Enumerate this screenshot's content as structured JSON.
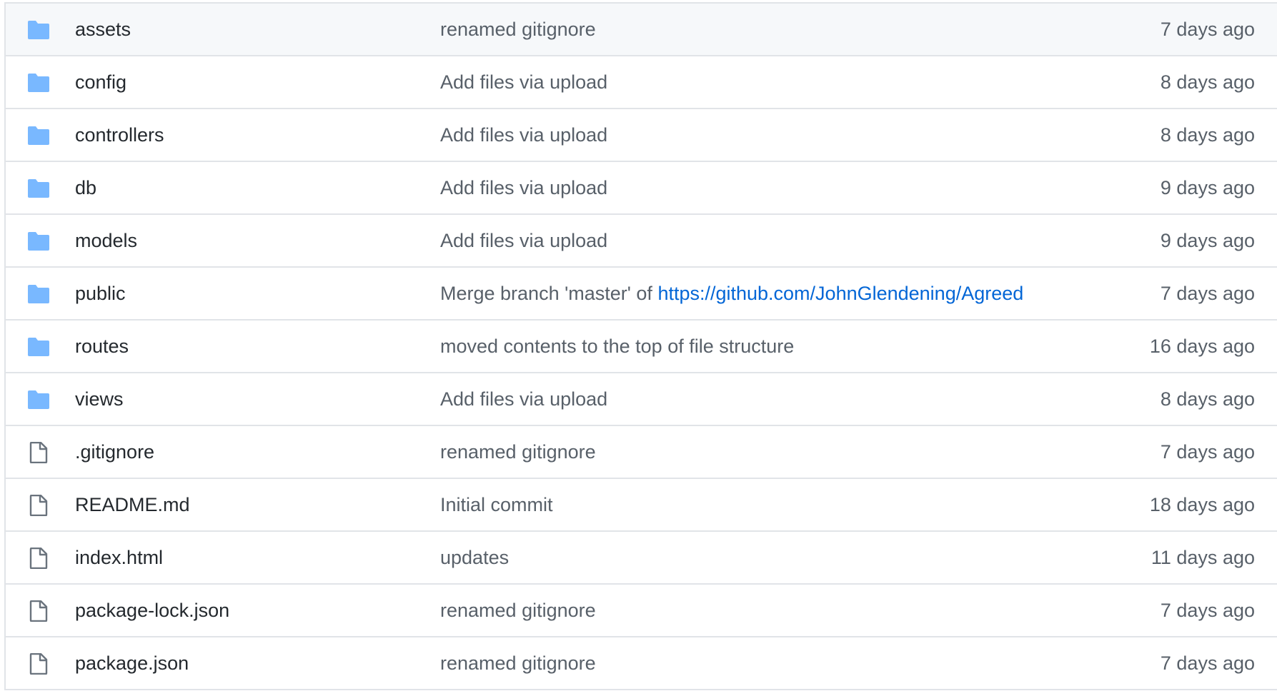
{
  "colors": {
    "folder_icon": "#79b8ff",
    "file_icon": "#6a737d",
    "link": "#0366d6",
    "muted_text": "#586069",
    "primary_text": "#24292e",
    "border": "#e1e4e8",
    "highlight_row": "#f6f8fa"
  },
  "rows": [
    {
      "type": "folder",
      "icon": "folder-icon",
      "name": "assets",
      "message": "renamed gitignore",
      "age": "7 days ago"
    },
    {
      "type": "folder",
      "icon": "folder-icon",
      "name": "config",
      "message": "Add files via upload",
      "age": "8 days ago"
    },
    {
      "type": "folder",
      "icon": "folder-icon",
      "name": "controllers",
      "message": "Add files via upload",
      "age": "8 days ago"
    },
    {
      "type": "folder",
      "icon": "folder-icon",
      "name": "db",
      "message": "Add files via upload",
      "age": "9 days ago"
    },
    {
      "type": "folder",
      "icon": "folder-icon",
      "name": "models",
      "message": "Add files via upload",
      "age": "9 days ago"
    },
    {
      "type": "folder",
      "icon": "folder-icon",
      "name": "public",
      "message": "Merge branch 'master' of ",
      "message_link": "https://github.com/JohnGlendening/Agreed",
      "age": "7 days ago"
    },
    {
      "type": "folder",
      "icon": "folder-icon",
      "name": "routes",
      "message": "moved contents to the top of file structure",
      "age": "16 days ago"
    },
    {
      "type": "folder",
      "icon": "folder-icon",
      "name": "views",
      "message": "Add files via upload",
      "age": "8 days ago"
    },
    {
      "type": "file",
      "icon": "file-icon",
      "name": ".gitignore",
      "message": "renamed gitignore",
      "age": "7 days ago"
    },
    {
      "type": "file",
      "icon": "file-icon",
      "name": "README.md",
      "message": "Initial commit",
      "age": "18 days ago"
    },
    {
      "type": "file",
      "icon": "file-icon",
      "name": "index.html",
      "message": "updates",
      "age": "11 days ago"
    },
    {
      "type": "file",
      "icon": "file-icon",
      "name": "package-lock.json",
      "message": "renamed gitignore",
      "age": "7 days ago"
    },
    {
      "type": "file",
      "icon": "file-icon",
      "name": "package.json",
      "message": "renamed gitignore",
      "age": "7 days ago"
    }
  ]
}
